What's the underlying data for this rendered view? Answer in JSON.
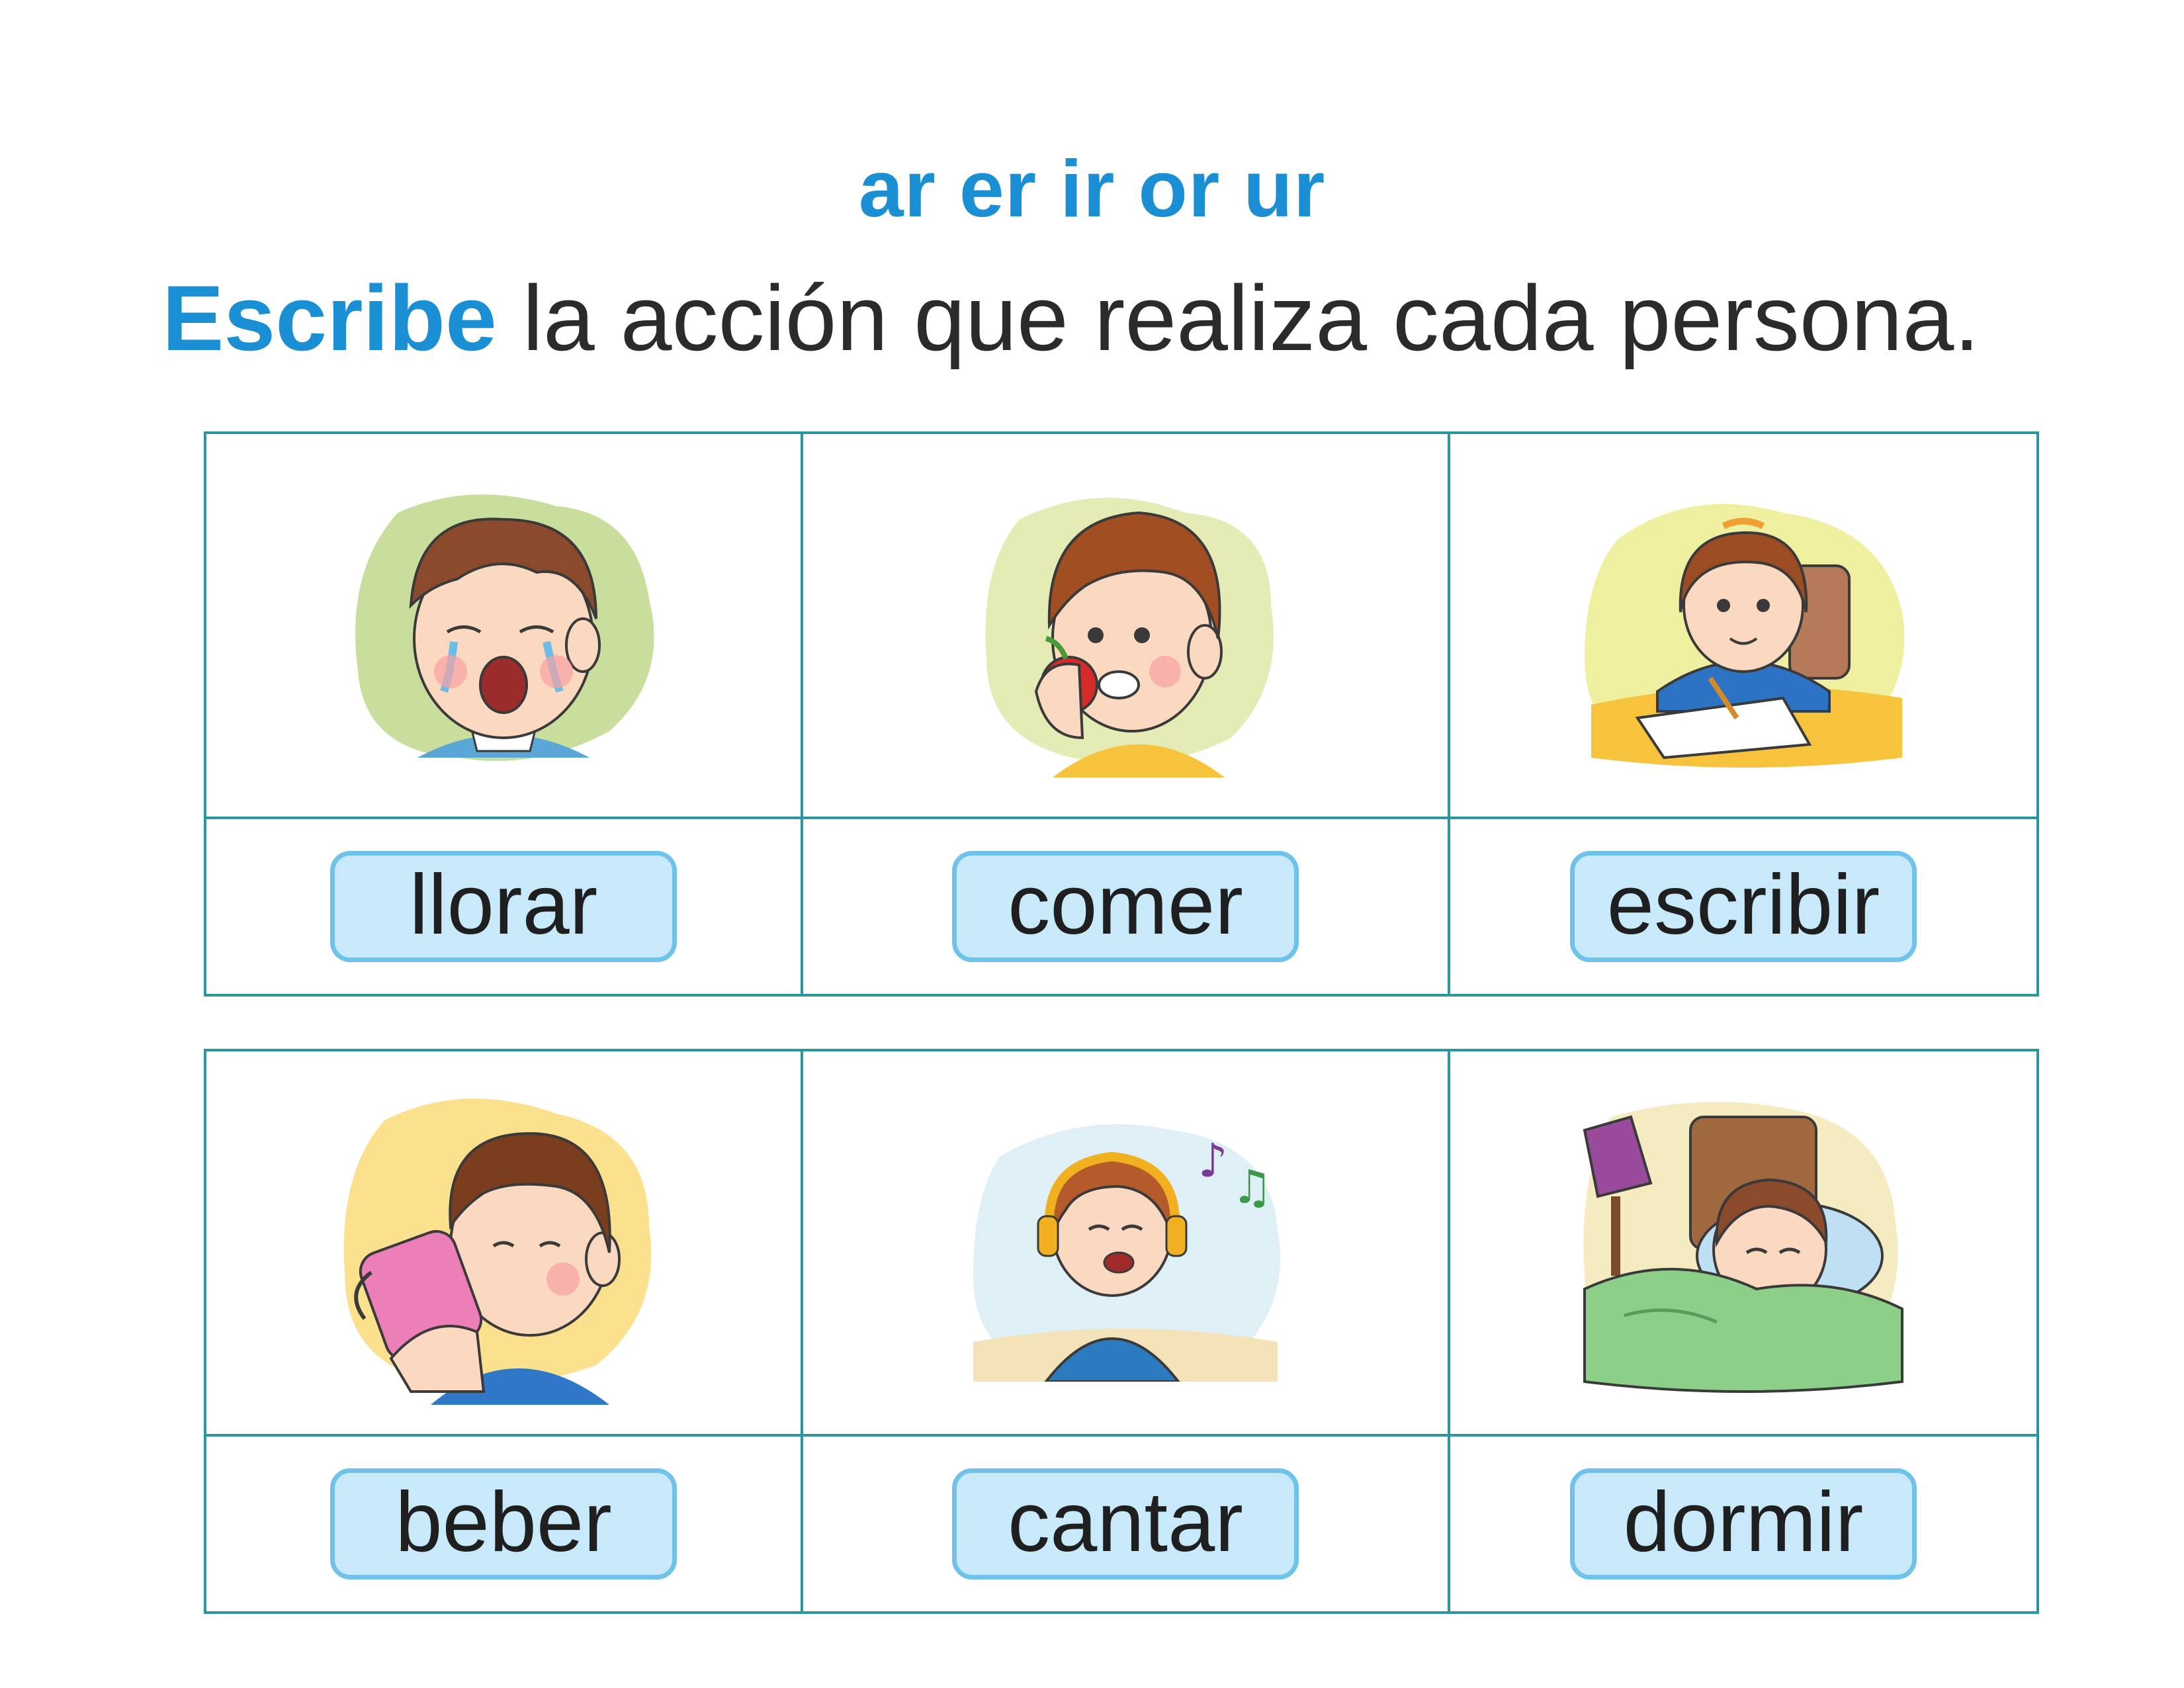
{
  "header": {
    "subtitle": "ar er ir or ur",
    "instruction_verb": "Escribe",
    "instruction_rest": " la acción que realiza cada persona."
  },
  "colors": {
    "accent_blue": "#1a8fd3",
    "table_border": "#2a96a0",
    "answer_fill": "#c7e9fa",
    "answer_border": "#6fc3ea"
  },
  "rows": [
    {
      "cells": [
        {
          "illustration": "crying-baby-icon",
          "answer": "llorar"
        },
        {
          "illustration": "boy-eating-apple-icon",
          "answer": "comer"
        },
        {
          "illustration": "girl-writing-icon",
          "answer": "escribir"
        }
      ]
    },
    {
      "cells": [
        {
          "illustration": "boy-drinking-icon",
          "answer": "beber"
        },
        {
          "illustration": "girl-singing-headphones-icon",
          "answer": "cantar"
        },
        {
          "illustration": "child-sleeping-icon",
          "answer": "dormir"
        }
      ]
    }
  ]
}
